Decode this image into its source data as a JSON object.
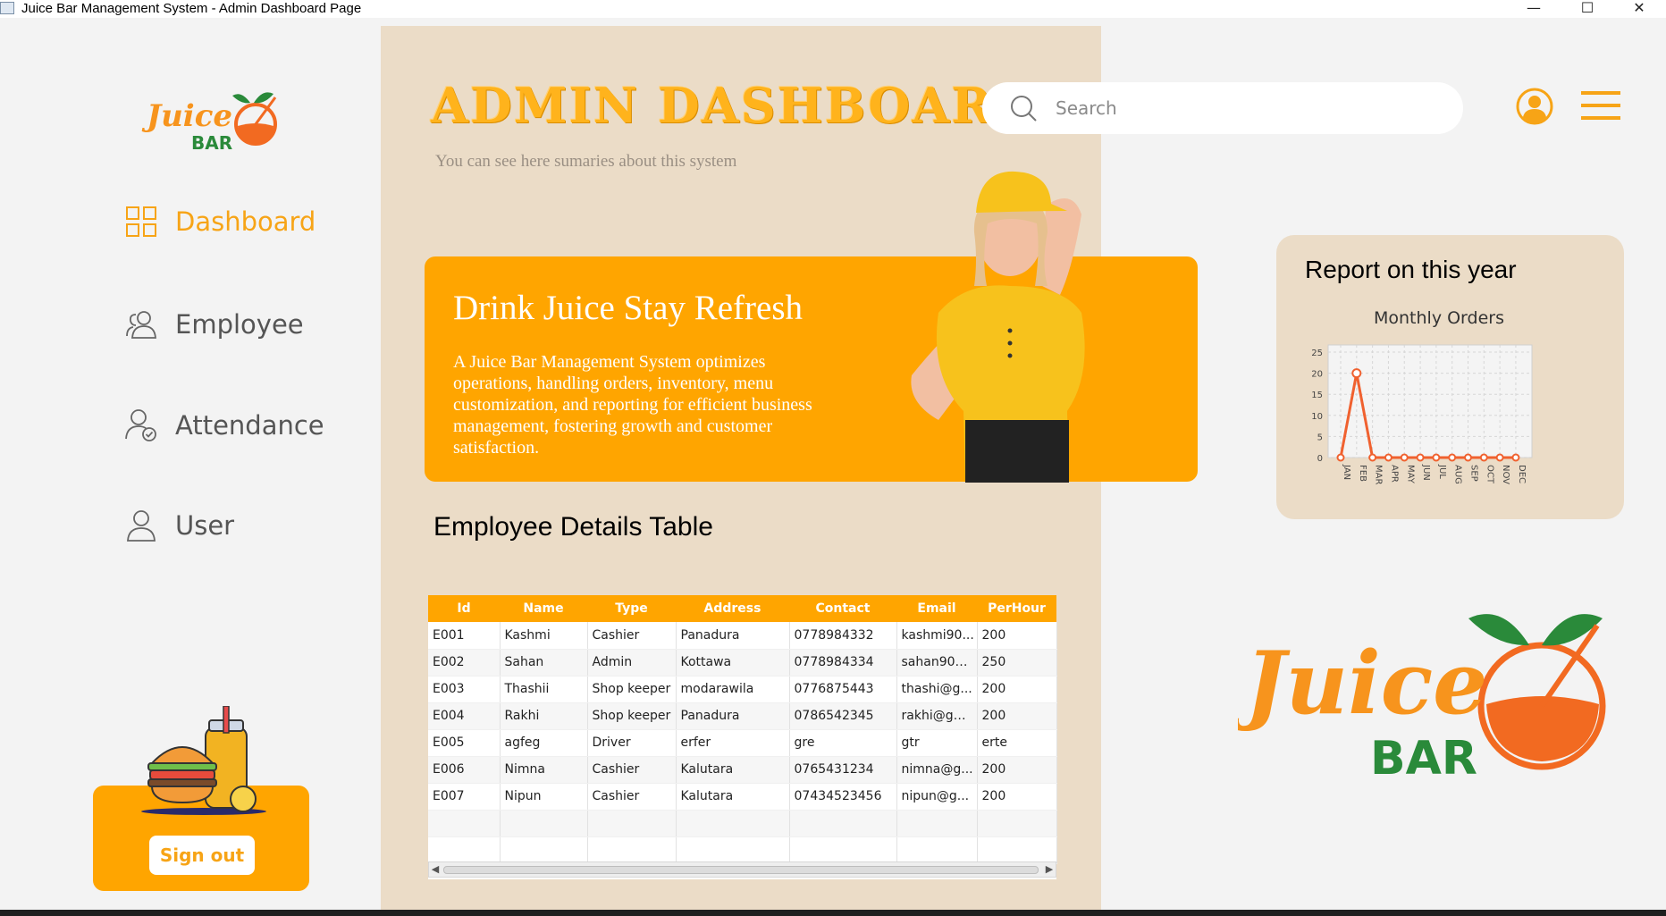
{
  "window": {
    "title": "Juice Bar Management System - Admin Dashboard Page",
    "minimize": "—",
    "maximize": "☐",
    "close": "✕"
  },
  "brand": {
    "logo_word1": "Juice",
    "logo_word2": "BAR"
  },
  "sidebar": {
    "items": [
      {
        "label": "Dashboard",
        "icon": "grid-icon",
        "active": true
      },
      {
        "label": "Employee",
        "icon": "users-icon",
        "active": false
      },
      {
        "label": "Attendance",
        "icon": "user-check-icon",
        "active": false
      },
      {
        "label": "User",
        "icon": "user-icon",
        "active": false
      }
    ],
    "signout_label": "Sign out"
  },
  "header": {
    "title": "ADMIN DASHBOARD",
    "subtitle": "You can see here sumaries about this system",
    "search_placeholder": "Search"
  },
  "banner": {
    "title": "Drink Juice Stay Refresh",
    "text": "A Juice Bar Management System optimizes operations, handling orders, inventory, menu customization, and reporting for efficient business management, fostering growth and customer satisfaction."
  },
  "employees": {
    "title": "Employee Details Table",
    "columns": [
      "Id",
      "Name",
      "Type",
      "Address",
      "Contact",
      "Email",
      "PerHour"
    ],
    "rows": [
      [
        "E001",
        "Kashmi",
        "Cashier",
        "Panadura",
        "0778984332",
        "kashmi90...",
        "200"
      ],
      [
        "E002",
        "Sahan",
        "Admin",
        "Kottawa",
        "0778984334",
        "sahan90@...",
        "250"
      ],
      [
        "E003",
        "Thashii",
        "Shop keeper",
        "modarawila",
        "0776875443",
        "thashi@g...",
        "200"
      ],
      [
        "E004",
        "Rakhi",
        "Shop keeper",
        "Panadura",
        "0786542345",
        "rakhi@gm...",
        "200"
      ],
      [
        "E005",
        "agfeg",
        "Driver",
        "erfer",
        "gre",
        "gtr",
        "erte"
      ],
      [
        "E006",
        "Nimna",
        "Cashier",
        "Kalutara",
        "0765431234",
        "nimna@g...",
        "200"
      ],
      [
        "E007",
        "Nipun",
        "Cashier",
        "Kalutara",
        "07434523456",
        "nipun@g...",
        "200"
      ],
      [
        "",
        "",
        "",
        "",
        "",
        "",
        ""
      ],
      [
        "",
        "",
        "",
        "",
        "",
        "",
        ""
      ]
    ]
  },
  "report": {
    "title": "Report on this year"
  },
  "chart_data": {
    "type": "line",
    "title": "Monthly  Orders",
    "categories": [
      "JAN",
      "FEB",
      "MAR",
      "APR",
      "MAY",
      "JUN",
      "JUL",
      "AUG",
      "SEP",
      "OCT",
      "NOV",
      "DEC"
    ],
    "values": [
      0,
      20,
      0,
      0,
      0,
      0,
      0,
      0,
      0,
      0,
      0,
      0
    ],
    "yticks": [
      0,
      5,
      10,
      15,
      20,
      25
    ],
    "ylim": [
      0,
      25
    ],
    "grid": true,
    "color": "#f0612f"
  }
}
